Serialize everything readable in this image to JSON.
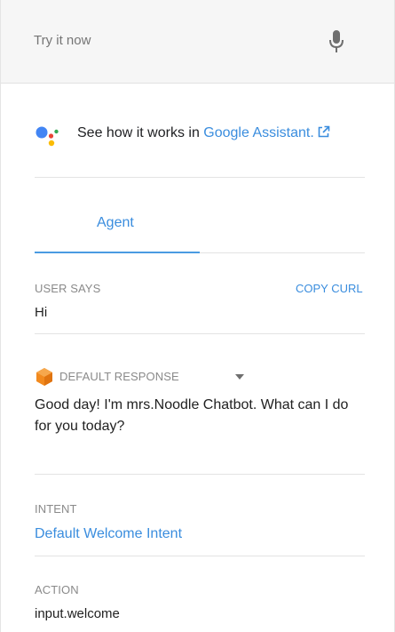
{
  "try_bar": {
    "placeholder": "Try it now",
    "mic_icon": "microphone-icon"
  },
  "assistant": {
    "prefix": "See how it works in ",
    "link_text": "Google Assistant.",
    "logo_icon": "google-assistant-logo",
    "external_icon": "external-link-icon"
  },
  "tabs": [
    {
      "label": "Agent",
      "active": true
    }
  ],
  "user_says": {
    "label": "USER SAYS",
    "copy_label": "COPY CURL",
    "value": "Hi"
  },
  "response": {
    "label": "DEFAULT RESPONSE",
    "icon": "default-response-icon",
    "text": "Good day! I'm mrs.Noodle Chatbot. What can I do for you today?"
  },
  "intent": {
    "label": "INTENT",
    "value": "Default Welcome Intent"
  },
  "action": {
    "label": "ACTION",
    "value": "input.welcome"
  },
  "colors": {
    "accent": "#3a8dde",
    "tab_underline": "#4a9be2",
    "response_icon": "#f28a1e",
    "ga_blue": "#4285f4",
    "ga_red": "#ea4335",
    "ga_yellow": "#fbbc05",
    "ga_green": "#34a853"
  }
}
